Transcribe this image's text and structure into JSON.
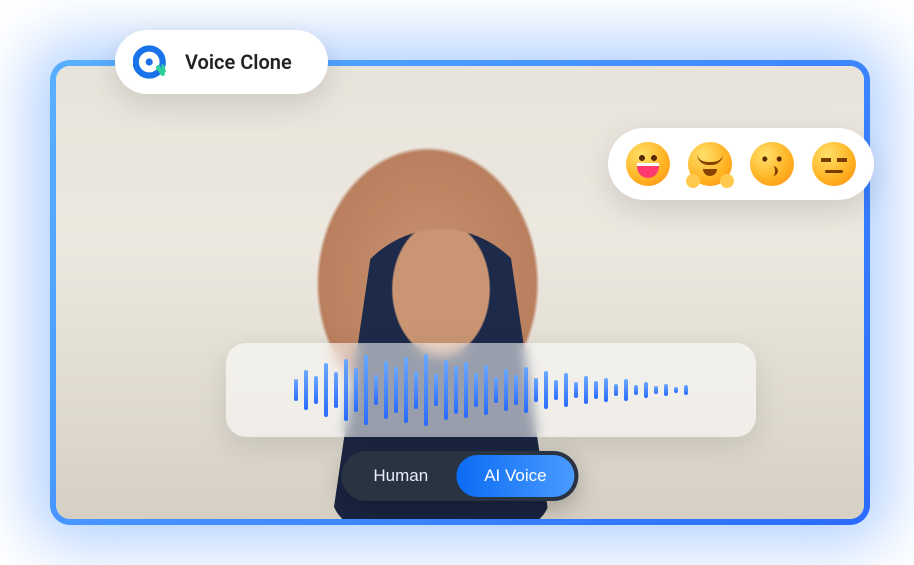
{
  "chip": {
    "label": "Voice Clone"
  },
  "emojis": [
    {
      "name": "grinning-emoji"
    },
    {
      "name": "hugging-emoji"
    },
    {
      "name": "kissing-emoji"
    },
    {
      "name": "expressionless-emoji"
    }
  ],
  "waveform": {
    "bars": [
      22,
      40,
      28,
      54,
      36,
      62,
      44,
      70,
      30,
      58,
      46,
      66,
      38,
      72,
      32,
      60,
      48,
      56,
      34,
      50,
      26,
      42,
      30,
      46,
      24,
      38,
      20,
      34,
      16,
      28,
      18,
      24,
      12,
      22,
      10,
      16,
      8,
      12,
      6,
      10
    ]
  },
  "toggle": {
    "option_a": "Human",
    "option_b": "AI Voice",
    "active": "b"
  }
}
